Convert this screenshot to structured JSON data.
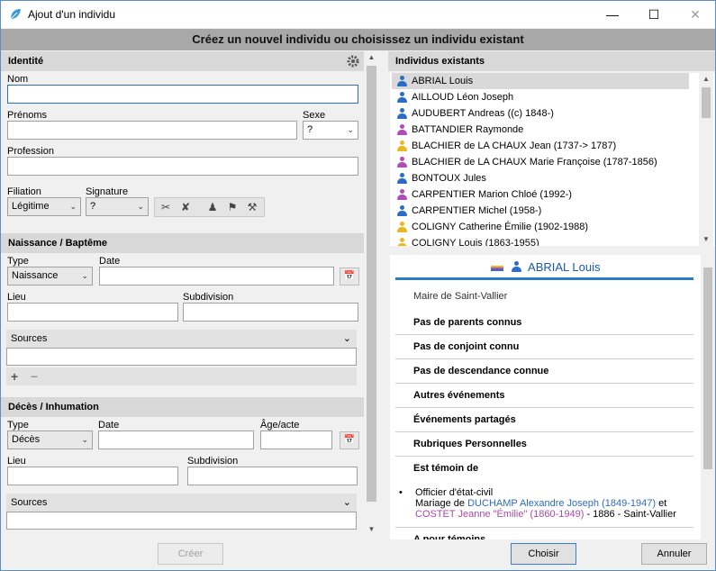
{
  "window": {
    "title": "Ajout d'un individu",
    "minimize": "—",
    "maximize": "☐",
    "close": "✕"
  },
  "banner": "Créez un nouvel individu ou choisissez un individu existant",
  "identite": {
    "title": "Identité",
    "nom_label": "Nom",
    "nom_value": "",
    "prenoms_label": "Prénoms",
    "prenoms_value": "",
    "sexe_label": "Sexe",
    "sexe_value": "?",
    "profession_label": "Profession",
    "profession_value": "",
    "filiation_label": "Filiation",
    "filiation_value": "Légitime",
    "signature_label": "Signature",
    "signature_value": "?"
  },
  "naissance": {
    "title": "Naissance / Baptême",
    "type_label": "Type",
    "type_value": "Naissance",
    "date_label": "Date",
    "date_value": "",
    "lieu_label": "Lieu",
    "lieu_value": "",
    "subdivision_label": "Subdivision",
    "subdivision_value": "",
    "sources_label": "Sources"
  },
  "deces": {
    "title": "Décès / Inhumation",
    "type_label": "Type",
    "type_value": "Décès",
    "date_label": "Date",
    "date_value": "",
    "age_label": "Âge/acte",
    "age_value": "",
    "lieu_label": "Lieu",
    "lieu_value": "",
    "subdivision_label": "Subdivision",
    "subdivision_value": "",
    "sources_label": "Sources"
  },
  "existants": {
    "title": "Individus existants",
    "rows": [
      {
        "name": "ABRIAL Louis",
        "sex": "m"
      },
      {
        "name": "AILLOUD Léon Joseph",
        "sex": "m"
      },
      {
        "name": "AUDUBERT Andreas ((c) 1848-)",
        "sex": "m"
      },
      {
        "name": "BATTANDIER Raymonde",
        "sex": "f"
      },
      {
        "name": "BLACHIER de LA CHAUX Jean (1737-> 1787)",
        "sex": "u"
      },
      {
        "name": "BLACHIER de LA CHAUX Marie Françoise (1787-1856)",
        "sex": "f"
      },
      {
        "name": "BONTOUX Jules",
        "sex": "m"
      },
      {
        "name": "CARPENTIER Marion Chloé (1992-)",
        "sex": "f"
      },
      {
        "name": "CARPENTIER Michel (1958-)",
        "sex": "m"
      },
      {
        "name": "COLIGNY Catherine Émilie (1902-1988)",
        "sex": "u"
      },
      {
        "name": "COLIGNY Louis (1863-1955)",
        "sex": "u"
      }
    ]
  },
  "detail": {
    "name": "ABRIAL Louis",
    "occupation": "Maire de Saint-Vallier",
    "items": [
      "Pas de parents connus",
      "Pas de conjoint connu",
      "Pas de descendance connue",
      "Autres événements",
      "Événements partagés",
      "Rubriques Personnelles",
      "Est témoin de"
    ],
    "witness": {
      "role": "Officier d'état-civil",
      "prefix": "Mariage de",
      "person1": "DUCHAMP Alexandre Joseph (1849-1947)",
      "conj": "et",
      "person2": "COSTET Jeanne \"Émilie\" (1860-1949)",
      "suffix": "- 1886 - Saint-Vallier"
    },
    "next_item": "A pour témoins"
  },
  "footer": {
    "creer": "Créer",
    "choisir": "Choisir",
    "annuler": "Annuler"
  },
  "colors": {
    "male": "#2a6cc6",
    "female": "#b04cb8",
    "unknown": "#e8b820",
    "accent": "#2a7ec0"
  }
}
